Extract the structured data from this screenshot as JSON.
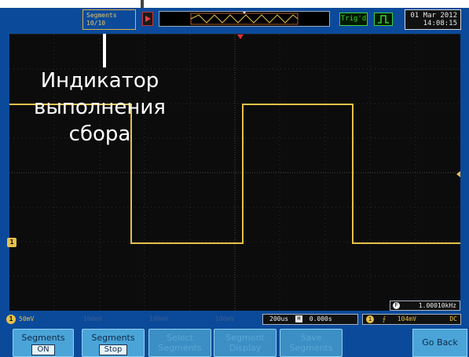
{
  "topbar": {
    "segments_label": "Segments",
    "segments_count": "10/10",
    "trigger_status": "Trig'd",
    "date": "01 Mar 2012",
    "time": "14:08:15"
  },
  "annotation": {
    "text": "Индикатор выполнения сбора"
  },
  "statusbar": {
    "ch1_marker": "1",
    "ch1_scale": "50mV",
    "ch2_text": "100mV",
    "ch3_text": "100mV",
    "ch4_text": "100mV",
    "timebase": "200us",
    "position": "0.000s",
    "trigger_level": "104mV",
    "coupling": "DC",
    "frequency": "1.00010kHz"
  },
  "softkeys": [
    {
      "label": "Segments",
      "value": "ON"
    },
    {
      "label": "Segments",
      "value": "Stop"
    },
    {
      "label": "Select",
      "value": "Segments"
    },
    {
      "label": "Segment",
      "value": "Display"
    },
    {
      "label": "Save",
      "value": "Segments"
    }
  ],
  "go_back_label": "Go Back",
  "colors": {
    "bezel": "#0b4a9a",
    "trace": "#e5c04a",
    "softkey": "#4aa4d8"
  },
  "icons": [
    "run-stop-icon",
    "rising-edge-icon",
    "channel-1-icon",
    "frequency-f-icon",
    "trigger-marker-icon"
  ]
}
